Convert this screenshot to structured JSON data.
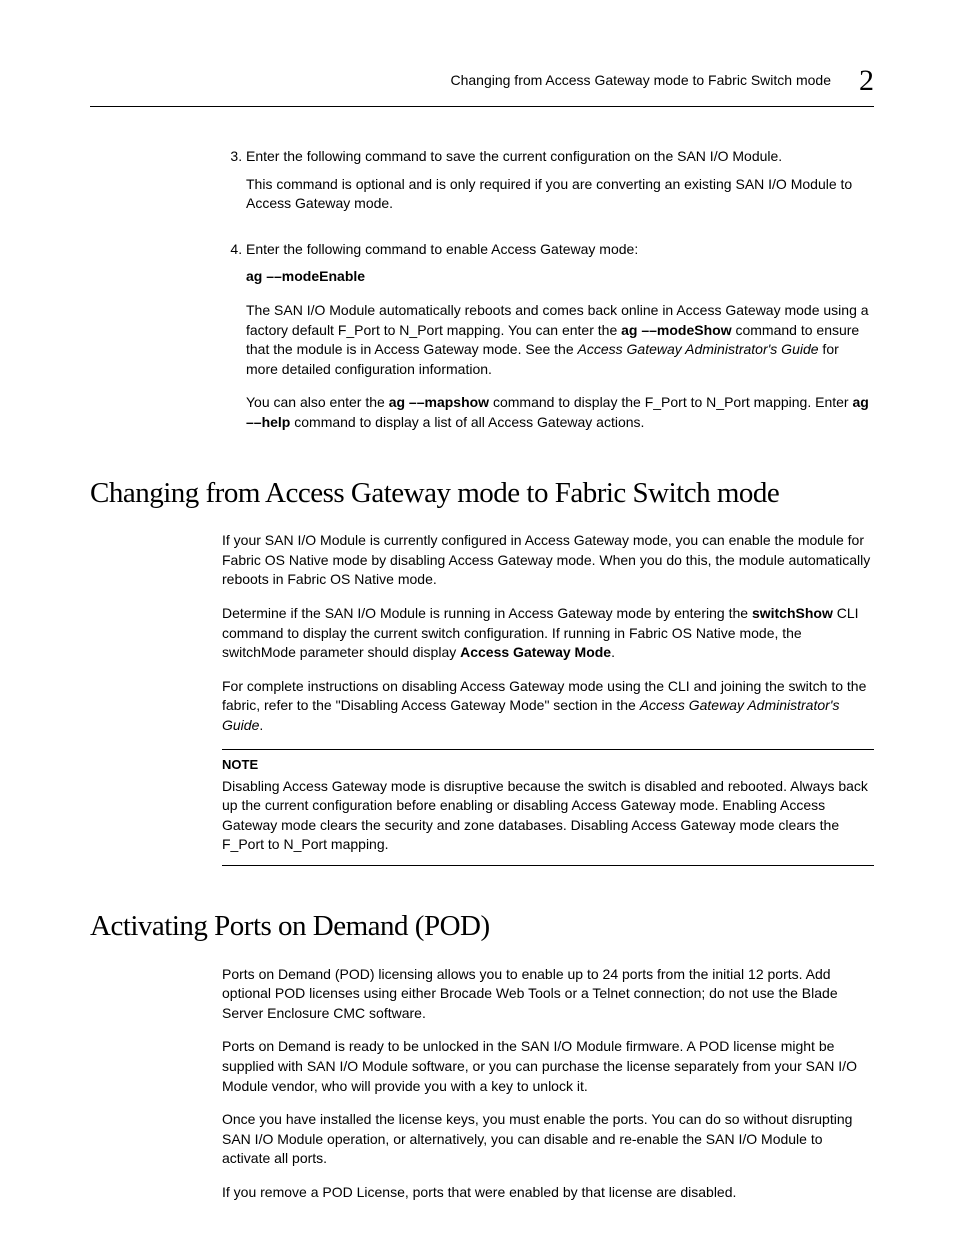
{
  "header": {
    "running_title": "Changing from Access Gateway mode to Fabric Switch mode",
    "chapter_number": "2"
  },
  "step3": {
    "num": "3",
    "line1": "Enter the following command to save the current configuration on the SAN I/O Module.",
    "line2": "This command is optional and is only required if you are converting an existing SAN I/O Module to Access Gateway mode."
  },
  "step4": {
    "num": "4",
    "line1": "Enter the following command to enable Access Gateway mode:",
    "cmd": "ag ––modeEnable",
    "para2_a": "The SAN I/O Module automatically reboots and comes back online in Access Gateway mode using a factory default F_Port to N_Port mapping. You can enter the ",
    "para2_cmd1": "ag ––modeShow",
    "para2_b": " command to ensure that the module is in Access Gateway mode. See the ",
    "para2_doc": "Access Gateway Administrator's Guide",
    "para2_c": " for more detailed configuration information.",
    "para3_a": "You can also enter the ",
    "para3_cmd1": "ag ––mapshow",
    "para3_b": " command to display the F_Port to N_Port mapping. Enter ",
    "para3_cmd2": "ag ––help",
    "para3_c": " command to display a list of all Access Gateway actions."
  },
  "section1": {
    "title": "Changing from Access Gateway mode to Fabric Switch mode",
    "p1": "If your SAN I/O Module is currently configured in Access Gateway mode, you can enable the module for Fabric OS Native mode by disabling Access Gateway mode. When you do this, the module automatically reboots in Fabric OS Native mode.",
    "p2_a": "Determine if the SAN I/O Module is running in Access Gateway mode by entering the ",
    "p2_cmd1": "switchShow",
    "p2_b": " CLI command to display the current switch configuration. If running in Fabric OS Native mode, the switchMode parameter should display ",
    "p2_cmd2": "Access Gateway Mode",
    "p2_c": ".",
    "p3_a": "For complete instructions on disabling Access Gateway mode using the CLI and joining the switch to the fabric, refer to the \"Disabling Access Gateway Mode\" section in the ",
    "p3_doc": "Access Gateway Administrator's Guide",
    "p3_b": ".",
    "note_label": "NOTE",
    "note_body": "Disabling Access Gateway mode is disruptive because the switch is disabled and rebooted. Always back up the current configuration before enabling or disabling Access Gateway mode. Enabling Access Gateway mode clears the security and zone databases. Disabling Access Gateway mode clears the F_Port to N_Port mapping."
  },
  "section2": {
    "title": "Activating Ports on Demand (POD)",
    "p1": "Ports on Demand (POD) licensing allows you to enable up to 24 ports from the initial 12 ports. Add optional POD licenses using either Brocade Web Tools or a Telnet connection; do not use the Blade Server Enclosure CMC software.",
    "p2": "Ports on Demand is ready to be unlocked in the SAN I/O Module firmware. A POD license might be supplied with SAN I/O Module software, or you can purchase the license separately from your SAN I/O Module vendor, who will provide you with a key to unlock it.",
    "p3": "Once you have installed the license keys, you must enable the ports. You can do so without disrupting SAN I/O Module operation, or alternatively, you can disable and re-enable the SAN I/O Module to activate all ports.",
    "p4": "If you remove a POD License, ports that were enabled by that license are disabled."
  }
}
